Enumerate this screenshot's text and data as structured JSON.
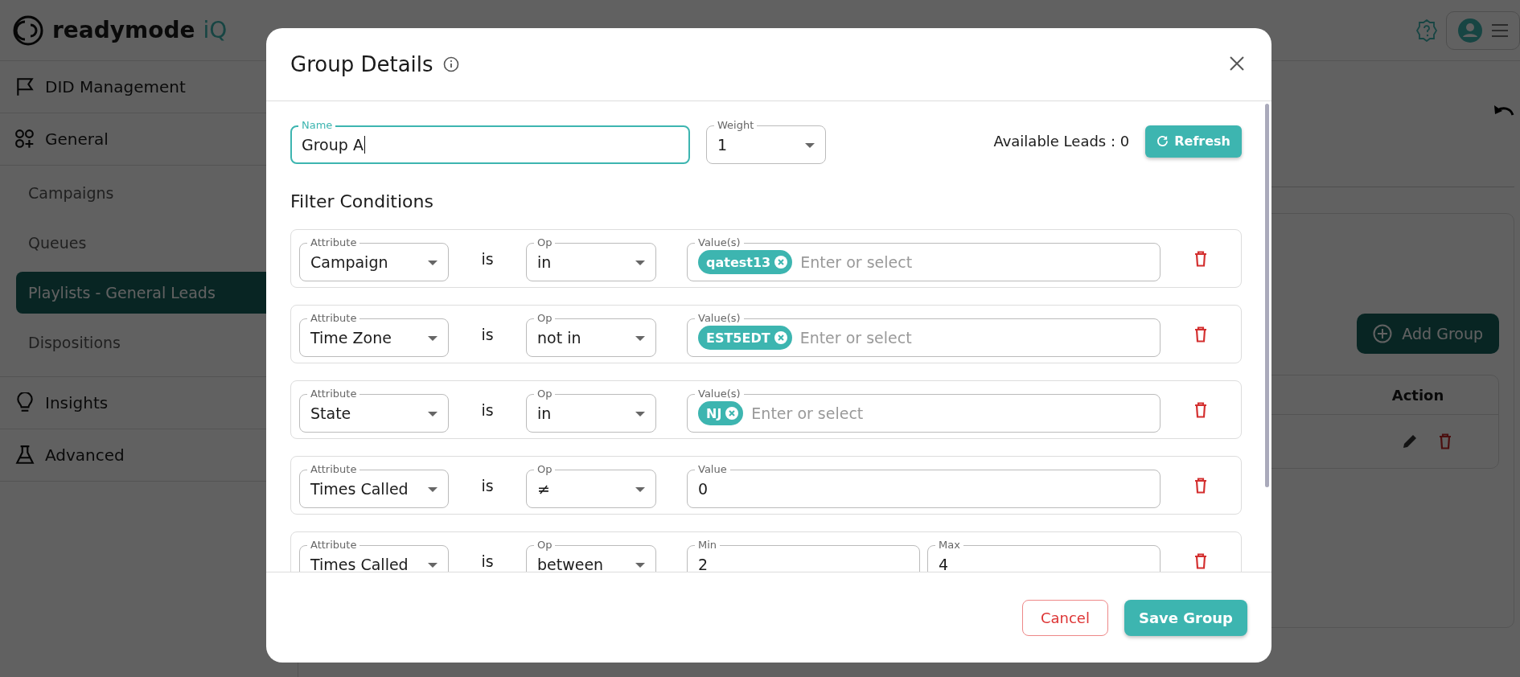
{
  "app": {
    "logo_text": "readymode",
    "logo_suffix": "iQ"
  },
  "sidebar": {
    "items": [
      {
        "label": "DID Management"
      },
      {
        "label": "General",
        "children": [
          {
            "label": "Campaigns",
            "selected": false
          },
          {
            "label": "Queues",
            "selected": false
          },
          {
            "label": "Playlists - General Leads",
            "selected": true
          },
          {
            "label": "Dispositions",
            "selected": false
          }
        ]
      },
      {
        "label": "Insights"
      },
      {
        "label": "Advanced"
      }
    ]
  },
  "main": {
    "add_button": "Add Group",
    "table": {
      "columns": [
        "Action"
      ]
    }
  },
  "dialog": {
    "title": "Group Details",
    "name_field": {
      "label": "Name",
      "value": "Group A"
    },
    "weight_field": {
      "label": "Weight",
      "value": "1"
    },
    "available_leads": "Available Leads : 0",
    "refresh_button": "Refresh",
    "section_title": "Filter Conditions",
    "conditions": [
      {
        "kind": "multi",
        "attribute_label": "Attribute",
        "attribute": "Campaign",
        "connector": "is",
        "op_label": "Op",
        "op": "in",
        "value_label": "Value(s)",
        "chips": [
          "qatest13"
        ],
        "placeholder": "Enter or select"
      },
      {
        "kind": "multi",
        "attribute_label": "Attribute",
        "attribute": "Time Zone",
        "connector": "is",
        "op_label": "Op",
        "op": "not in",
        "value_label": "Value(s)",
        "chips": [
          "EST5EDT"
        ],
        "placeholder": "Enter or select"
      },
      {
        "kind": "multi",
        "attribute_label": "Attribute",
        "attribute": "State",
        "connector": "is",
        "op_label": "Op",
        "op": "in",
        "value_label": "Value(s)",
        "chips": [
          "NJ"
        ],
        "placeholder": "Enter or select"
      },
      {
        "kind": "single",
        "attribute_label": "Attribute",
        "attribute": "Times Called",
        "connector": "is",
        "op_label": "Op",
        "op": "≠",
        "value_label": "Value",
        "value": "0"
      },
      {
        "kind": "range",
        "attribute_label": "Attribute",
        "attribute": "Times Called",
        "connector": "is",
        "op_label": "Op",
        "op": "between",
        "min_label": "Min",
        "min": "2",
        "max_label": "Max",
        "max": "4"
      }
    ],
    "cancel_button": "Cancel",
    "save_button": "Save Group"
  }
}
